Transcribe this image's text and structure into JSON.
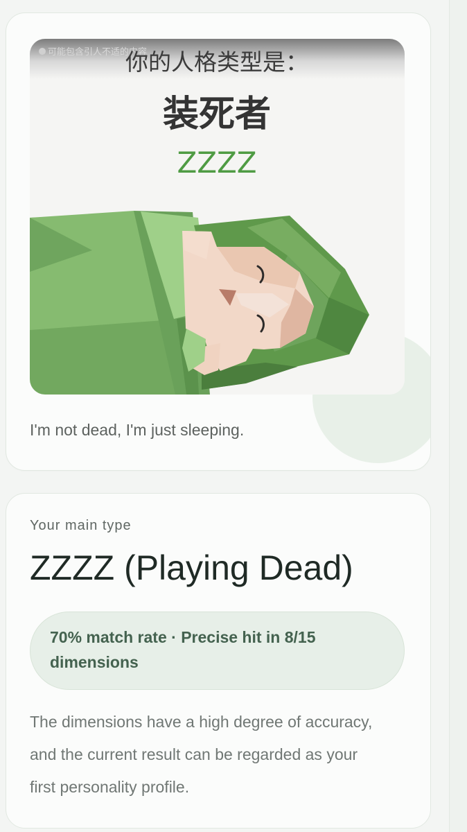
{
  "hero": {
    "watermark": "可能包含引人不适的内容",
    "title_cn": "你的人格类型是：",
    "type_cn": "装死者",
    "type_code": "ZZZZ",
    "caption": "I'm not dead, I'm just sleeping.",
    "colors": {
      "accent_green": "#5b9a45",
      "title_dark": "#343434"
    }
  },
  "result": {
    "label": "Your main type",
    "title": "ZZZZ (Playing Dead)",
    "match": {
      "text": "70% match rate · Precise hit in 8/15 dimensions",
      "rate_percent": 70,
      "dimensions_hit": 8,
      "dimensions_total": 15
    },
    "description": "The dimensions have a high degree of accuracy, and the current result can be regarded as your first personality profile."
  }
}
